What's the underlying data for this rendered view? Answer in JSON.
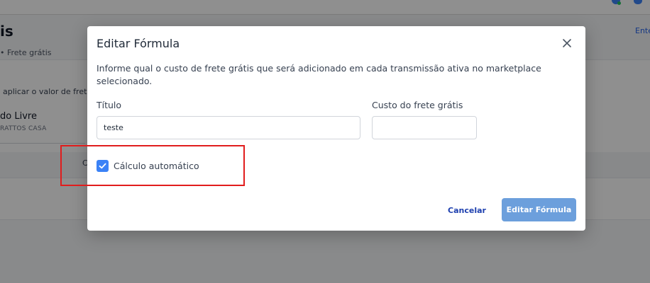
{
  "background": {
    "title": "is",
    "breadcrumb": "• Frete grátis",
    "top_link": "Ente",
    "description": "aplicar o valor de frete",
    "marketplace": "do Livre",
    "store": "RATTOS CASA",
    "column_fragment": "C"
  },
  "modal": {
    "title": "Editar Fórmula",
    "description": "Informe qual o custo de frete grátis que será adicionado em cada transmissão ativa no marketplace selecionado.",
    "fields": {
      "title_label": "Título",
      "title_value": "teste",
      "cost_label": "Custo do frete grátis",
      "cost_value": ""
    },
    "auto_calc": {
      "label": "Cálculo automático",
      "checked": true
    },
    "buttons": {
      "cancel": "Cancelar",
      "submit": "Editar Fórmula"
    }
  },
  "colors": {
    "accent": "#3b82f6",
    "submit_button": "#6c9fdc",
    "highlight_box": "#e11d1d",
    "overlay": "rgba(0,0,0,0.44)"
  },
  "icons": [
    "close-icon",
    "checkmark-icon",
    "notification-bell-icon",
    "status-icon"
  ]
}
